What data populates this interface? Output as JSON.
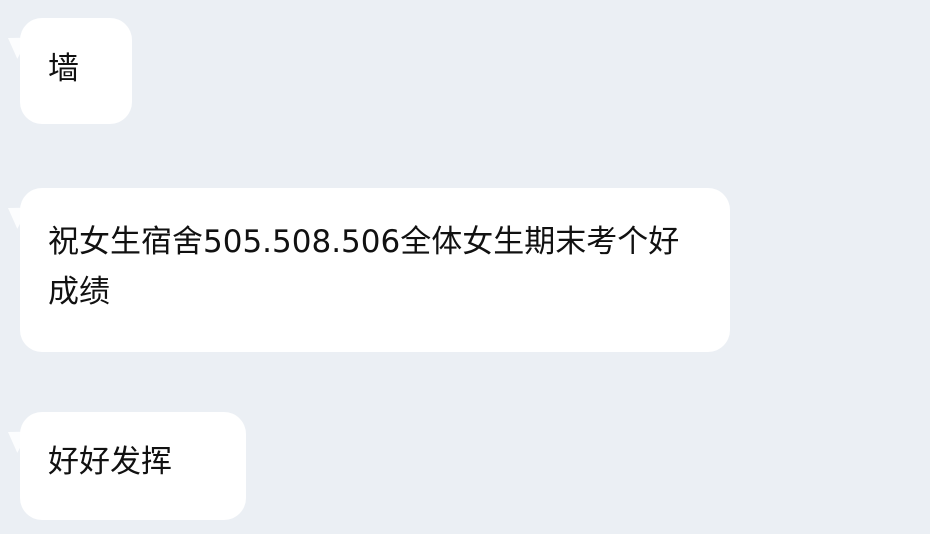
{
  "chat": {
    "messages": [
      {
        "text": "墙"
      },
      {
        "text": "祝女生宿舍505.508.506全体女生期末考个好成绩"
      },
      {
        "text": "好好发挥"
      }
    ]
  }
}
